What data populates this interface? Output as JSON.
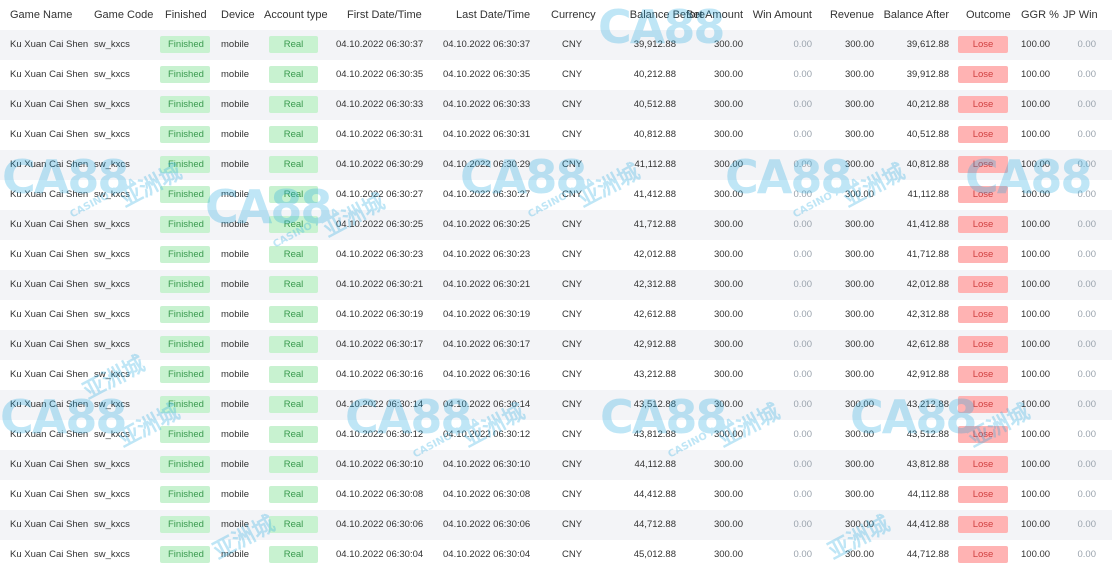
{
  "headers": [
    "Game Name",
    "Game Code",
    "Finished",
    "Device",
    "Account type",
    "First Date/Time",
    "Last Date/Time",
    "Currency",
    "Balance Before",
    "Bet Amount",
    "Win Amount",
    "Revenue",
    "Balance After",
    "Outcome",
    "GGR %",
    "JP Win"
  ],
  "rows": [
    [
      "Ku Xuan Cai Shen",
      "sw_kxcs",
      "Finished",
      "mobile",
      "Real",
      "04.10.2022 06:30:37",
      "04.10.2022 06:30:37",
      "CNY",
      "39,912.88",
      "300.00",
      "0.00",
      "300.00",
      "39,612.88",
      "Lose",
      "100.00",
      "0.00"
    ],
    [
      "Ku Xuan Cai Shen",
      "sw_kxcs",
      "Finished",
      "mobile",
      "Real",
      "04.10.2022 06:30:35",
      "04.10.2022 06:30:35",
      "CNY",
      "40,212.88",
      "300.00",
      "0.00",
      "300.00",
      "39,912.88",
      "Lose",
      "100.00",
      "0.00"
    ],
    [
      "Ku Xuan Cai Shen",
      "sw_kxcs",
      "Finished",
      "mobile",
      "Real",
      "04.10.2022 06:30:33",
      "04.10.2022 06:30:33",
      "CNY",
      "40,512.88",
      "300.00",
      "0.00",
      "300.00",
      "40,212.88",
      "Lose",
      "100.00",
      "0.00"
    ],
    [
      "Ku Xuan Cai Shen",
      "sw_kxcs",
      "Finished",
      "mobile",
      "Real",
      "04.10.2022 06:30:31",
      "04.10.2022 06:30:31",
      "CNY",
      "40,812.88",
      "300.00",
      "0.00",
      "300.00",
      "40,512.88",
      "Lose",
      "100.00",
      "0.00"
    ],
    [
      "Ku Xuan Cai Shen",
      "sw_kxcs",
      "Finished",
      "mobile",
      "Real",
      "04.10.2022 06:30:29",
      "04.10.2022 06:30:29",
      "CNY",
      "41,112.88",
      "300.00",
      "0.00",
      "300.00",
      "40,812.88",
      "Lose",
      "100.00",
      "0.00"
    ],
    [
      "Ku Xuan Cai Shen",
      "sw_kxcs",
      "Finished",
      "mobile",
      "Real",
      "04.10.2022 06:30:27",
      "04.10.2022 06:30:27",
      "CNY",
      "41,412.88",
      "300.00",
      "0.00",
      "300.00",
      "41,112.88",
      "Lose",
      "100.00",
      "0.00"
    ],
    [
      "Ku Xuan Cai Shen",
      "sw_kxcs",
      "Finished",
      "mobile",
      "Real",
      "04.10.2022 06:30:25",
      "04.10.2022 06:30:25",
      "CNY",
      "41,712.88",
      "300.00",
      "0.00",
      "300.00",
      "41,412.88",
      "Lose",
      "100.00",
      "0.00"
    ],
    [
      "Ku Xuan Cai Shen",
      "sw_kxcs",
      "Finished",
      "mobile",
      "Real",
      "04.10.2022 06:30:23",
      "04.10.2022 06:30:23",
      "CNY",
      "42,012.88",
      "300.00",
      "0.00",
      "300.00",
      "41,712.88",
      "Lose",
      "100.00",
      "0.00"
    ],
    [
      "Ku Xuan Cai Shen",
      "sw_kxcs",
      "Finished",
      "mobile",
      "Real",
      "04.10.2022 06:30:21",
      "04.10.2022 06:30:21",
      "CNY",
      "42,312.88",
      "300.00",
      "0.00",
      "300.00",
      "42,012.88",
      "Lose",
      "100.00",
      "0.00"
    ],
    [
      "Ku Xuan Cai Shen",
      "sw_kxcs",
      "Finished",
      "mobile",
      "Real",
      "04.10.2022 06:30:19",
      "04.10.2022 06:30:19",
      "CNY",
      "42,612.88",
      "300.00",
      "0.00",
      "300.00",
      "42,312.88",
      "Lose",
      "100.00",
      "0.00"
    ],
    [
      "Ku Xuan Cai Shen",
      "sw_kxcs",
      "Finished",
      "mobile",
      "Real",
      "04.10.2022 06:30:17",
      "04.10.2022 06:30:17",
      "CNY",
      "42,912.88",
      "300.00",
      "0.00",
      "300.00",
      "42,612.88",
      "Lose",
      "100.00",
      "0.00"
    ],
    [
      "Ku Xuan Cai Shen",
      "sw_kxcs",
      "Finished",
      "mobile",
      "Real",
      "04.10.2022 06:30:16",
      "04.10.2022 06:30:16",
      "CNY",
      "43,212.88",
      "300.00",
      "0.00",
      "300.00",
      "42,912.88",
      "Lose",
      "100.00",
      "0.00"
    ],
    [
      "Ku Xuan Cai Shen",
      "sw_kxcs",
      "Finished",
      "mobile",
      "Real",
      "04.10.2022 06:30:14",
      "04.10.2022 06:30:14",
      "CNY",
      "43,512.88",
      "300.00",
      "0.00",
      "300.00",
      "43,212.88",
      "Lose",
      "100.00",
      "0.00"
    ],
    [
      "Ku Xuan Cai Shen",
      "sw_kxcs",
      "Finished",
      "mobile",
      "Real",
      "04.10.2022 06:30:12",
      "04.10.2022 06:30:12",
      "CNY",
      "43,812.88",
      "300.00",
      "0.00",
      "300.00",
      "43,512.88",
      "Lose",
      "100.00",
      "0.00"
    ],
    [
      "Ku Xuan Cai Shen",
      "sw_kxcs",
      "Finished",
      "mobile",
      "Real",
      "04.10.2022 06:30:10",
      "04.10.2022 06:30:10",
      "CNY",
      "44,112.88",
      "300.00",
      "0.00",
      "300.00",
      "43,812.88",
      "Lose",
      "100.00",
      "0.00"
    ],
    [
      "Ku Xuan Cai Shen",
      "sw_kxcs",
      "Finished",
      "mobile",
      "Real",
      "04.10.2022 06:30:08",
      "04.10.2022 06:30:08",
      "CNY",
      "44,412.88",
      "300.00",
      "0.00",
      "300.00",
      "44,112.88",
      "Lose",
      "100.00",
      "0.00"
    ],
    [
      "Ku Xuan Cai Shen",
      "sw_kxcs",
      "Finished",
      "mobile",
      "Real",
      "04.10.2022 06:30:06",
      "04.10.2022 06:30:06",
      "CNY",
      "44,712.88",
      "300.00",
      "0.00",
      "300.00",
      "44,412.88",
      "Lose",
      "100.00",
      "0.00"
    ],
    [
      "Ku Xuan Cai Shen",
      "sw_kxcs",
      "Finished",
      "mobile",
      "Real",
      "04.10.2022 06:30:04",
      "04.10.2022 06:30:04",
      "CNY",
      "45,012.88",
      "300.00",
      "0.00",
      "300.00",
      "44,712.88",
      "Lose",
      "100.00",
      "0.00"
    ]
  ],
  "watermark": {
    "mark": "CA88",
    "chinese": "亚洲城",
    "sub": "CASINO ASIA"
  },
  "colors": {
    "finished_bg": "#c8f2d0",
    "finished_text": "#3a9a4e",
    "lose_bg": "#ffb3b3",
    "lose_text": "#d14040",
    "row_alt": "#f3f4f7",
    "watermark": "#1ea8e0"
  }
}
